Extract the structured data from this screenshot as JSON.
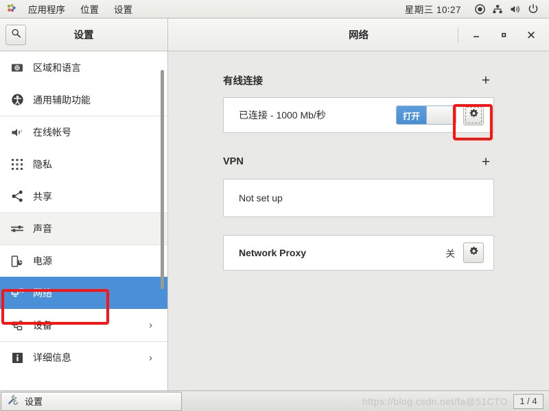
{
  "top_panel": {
    "logo_icon": "gnome-foot-icon",
    "menus": [
      {
        "label": "应用程序",
        "name": "menu-applications"
      },
      {
        "label": "位置",
        "name": "menu-places"
      },
      {
        "label": "设置",
        "name": "menu-settings"
      }
    ],
    "clock": "星期三 10∶27",
    "tray": [
      {
        "name": "recording-indicator-icon"
      },
      {
        "name": "network-wired-icon"
      },
      {
        "name": "volume-icon"
      },
      {
        "name": "power-icon"
      }
    ]
  },
  "window": {
    "sidebar_title": "设置",
    "content_title": "网络",
    "search_icon": "search-icon",
    "controls": {
      "minimize": "−",
      "maximize": "□",
      "close": "✕"
    }
  },
  "sidebar": {
    "items": [
      {
        "label": "区域和语言",
        "icon": "region-language-icon",
        "state": "normal",
        "chevron": ""
      },
      {
        "label": "通用辅助功能",
        "icon": "accessibility-icon",
        "state": "normal",
        "chevron": ""
      },
      {
        "label": "在线帐号",
        "icon": "online-accounts-icon",
        "state": "normal",
        "chevron": ""
      },
      {
        "label": "隐私",
        "icon": "privacy-icon",
        "state": "normal",
        "chevron": ""
      },
      {
        "label": "共享",
        "icon": "sharing-icon",
        "state": "normal",
        "chevron": ""
      },
      {
        "label": "声音",
        "icon": "sound-icon",
        "state": "hovered",
        "chevron": ""
      },
      {
        "label": "电源",
        "icon": "power-battery-icon",
        "state": "normal",
        "chevron": ""
      },
      {
        "label": "网络",
        "icon": "network-icon",
        "state": "selected",
        "chevron": ""
      },
      {
        "label": "设备",
        "icon": "devices-icon",
        "state": "normal",
        "chevron": "›"
      },
      {
        "label": "详细信息",
        "icon": "details-info-icon",
        "state": "normal",
        "chevron": "›"
      }
    ]
  },
  "content": {
    "wired": {
      "title": "有线连接",
      "add_label": "+",
      "row_label": "已连接 - 1000 Mb/秒",
      "switch_label": "打开",
      "gear_icon": "gear-icon"
    },
    "vpn": {
      "title": "VPN",
      "add_label": "+",
      "row_label": "Not set up"
    },
    "proxy": {
      "row_label": "Network Proxy",
      "status": "关",
      "gear_icon": "gear-icon"
    }
  },
  "taskbar": {
    "task_label": "设置",
    "task_icon": "tools-icon",
    "workspace": "1 / 4"
  },
  "watermark": "https://blog.csdn.net/fa@51CTO",
  "colors": {
    "accent_blue": "#4a90d9",
    "annotation_red": "#fb1414",
    "content_bg": "#e9e9e7",
    "sidebar_bg": "#ffffff"
  }
}
